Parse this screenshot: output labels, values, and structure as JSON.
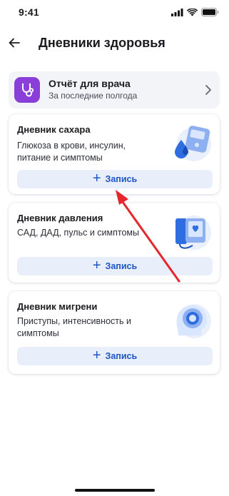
{
  "status_bar": {
    "time": "9:41",
    "icons": [
      "signal-icon",
      "wifi-icon",
      "battery-icon"
    ]
  },
  "header": {
    "title": "Дневники здоровья",
    "back_icon": "back-arrow-icon"
  },
  "report": {
    "title": "Отчёт для врача",
    "subtitle": "За последние полгода",
    "icon": "stethoscope-icon",
    "accent": "#8a3fd8"
  },
  "diaries": [
    {
      "title": "Дневник сахара",
      "description": "Глюкоза в крови, инсулин, питание и симптомы",
      "button": "Запись",
      "illustration": "glucometer-icon"
    },
    {
      "title": "Дневник давления",
      "description": "САД, ДАД, пульс и симптомы",
      "button": "Запись",
      "illustration": "tonometer-icon"
    },
    {
      "title": "Дневник мигрени",
      "description": "Приступы, интенсивность и симптомы",
      "button": "Запись",
      "illustration": "head-icon"
    }
  ],
  "colors": {
    "button_bg": "#e8eefa",
    "button_text": "#1f55c6",
    "annotation": "#e5262a"
  }
}
